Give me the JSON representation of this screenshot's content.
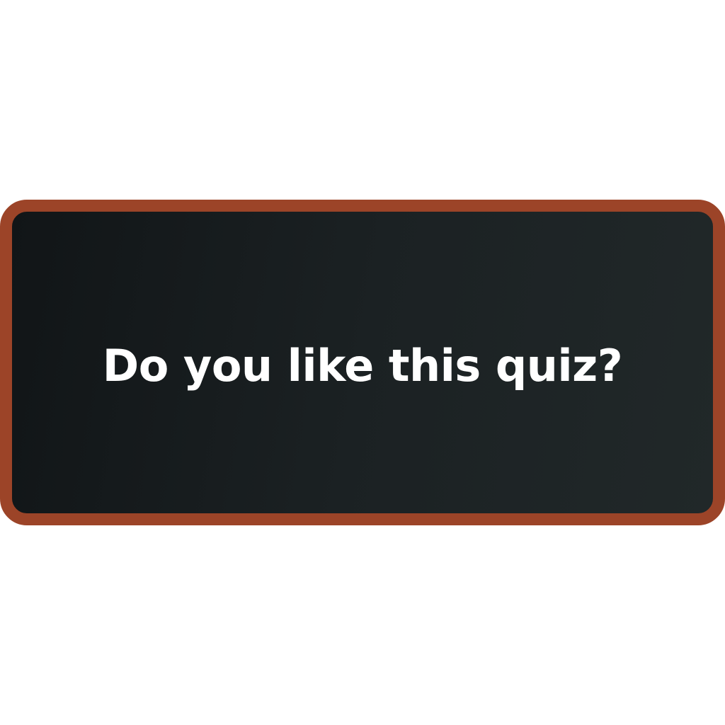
{
  "card": {
    "question": "Do you like this quiz?",
    "colors": {
      "border": "#9c4428",
      "background_start": "#111517",
      "background_end": "#212829",
      "text": "#ffffff"
    }
  }
}
